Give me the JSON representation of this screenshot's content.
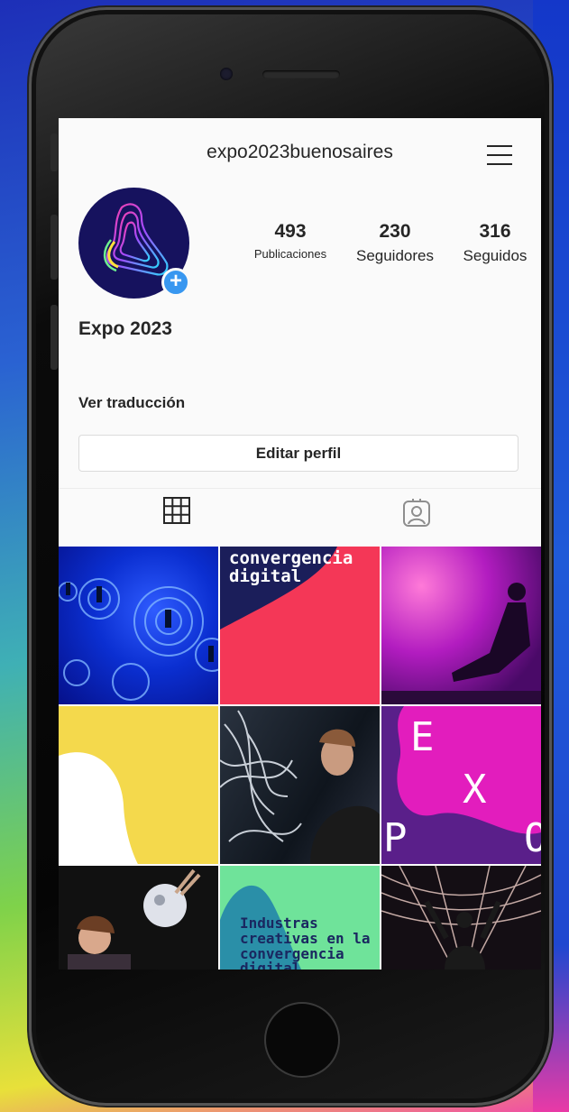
{
  "profile": {
    "username": "expo2023buenosaires",
    "display_name": "Expo 2023",
    "translate_label": "Ver traducción",
    "edit_label": "Editar perfil"
  },
  "stats": [
    {
      "value": "493",
      "label": "Publicaciones"
    },
    {
      "value": "230",
      "label": "Seguidores"
    },
    {
      "value": "316",
      "label": "Seguidos"
    }
  ],
  "posts": {
    "p2_text": "convergencia digital",
    "p6_letters": [
      "E",
      "X",
      "P",
      "O"
    ],
    "p8_text": "Industras creativas en la convergencia digital"
  },
  "colors": {
    "accent_blue": "#3897f0",
    "text": "#262626",
    "post_red": "#f43757",
    "post_yellow": "#f4d94c",
    "post_magenta": "#d624b1",
    "post_green": "#6fe39a"
  }
}
